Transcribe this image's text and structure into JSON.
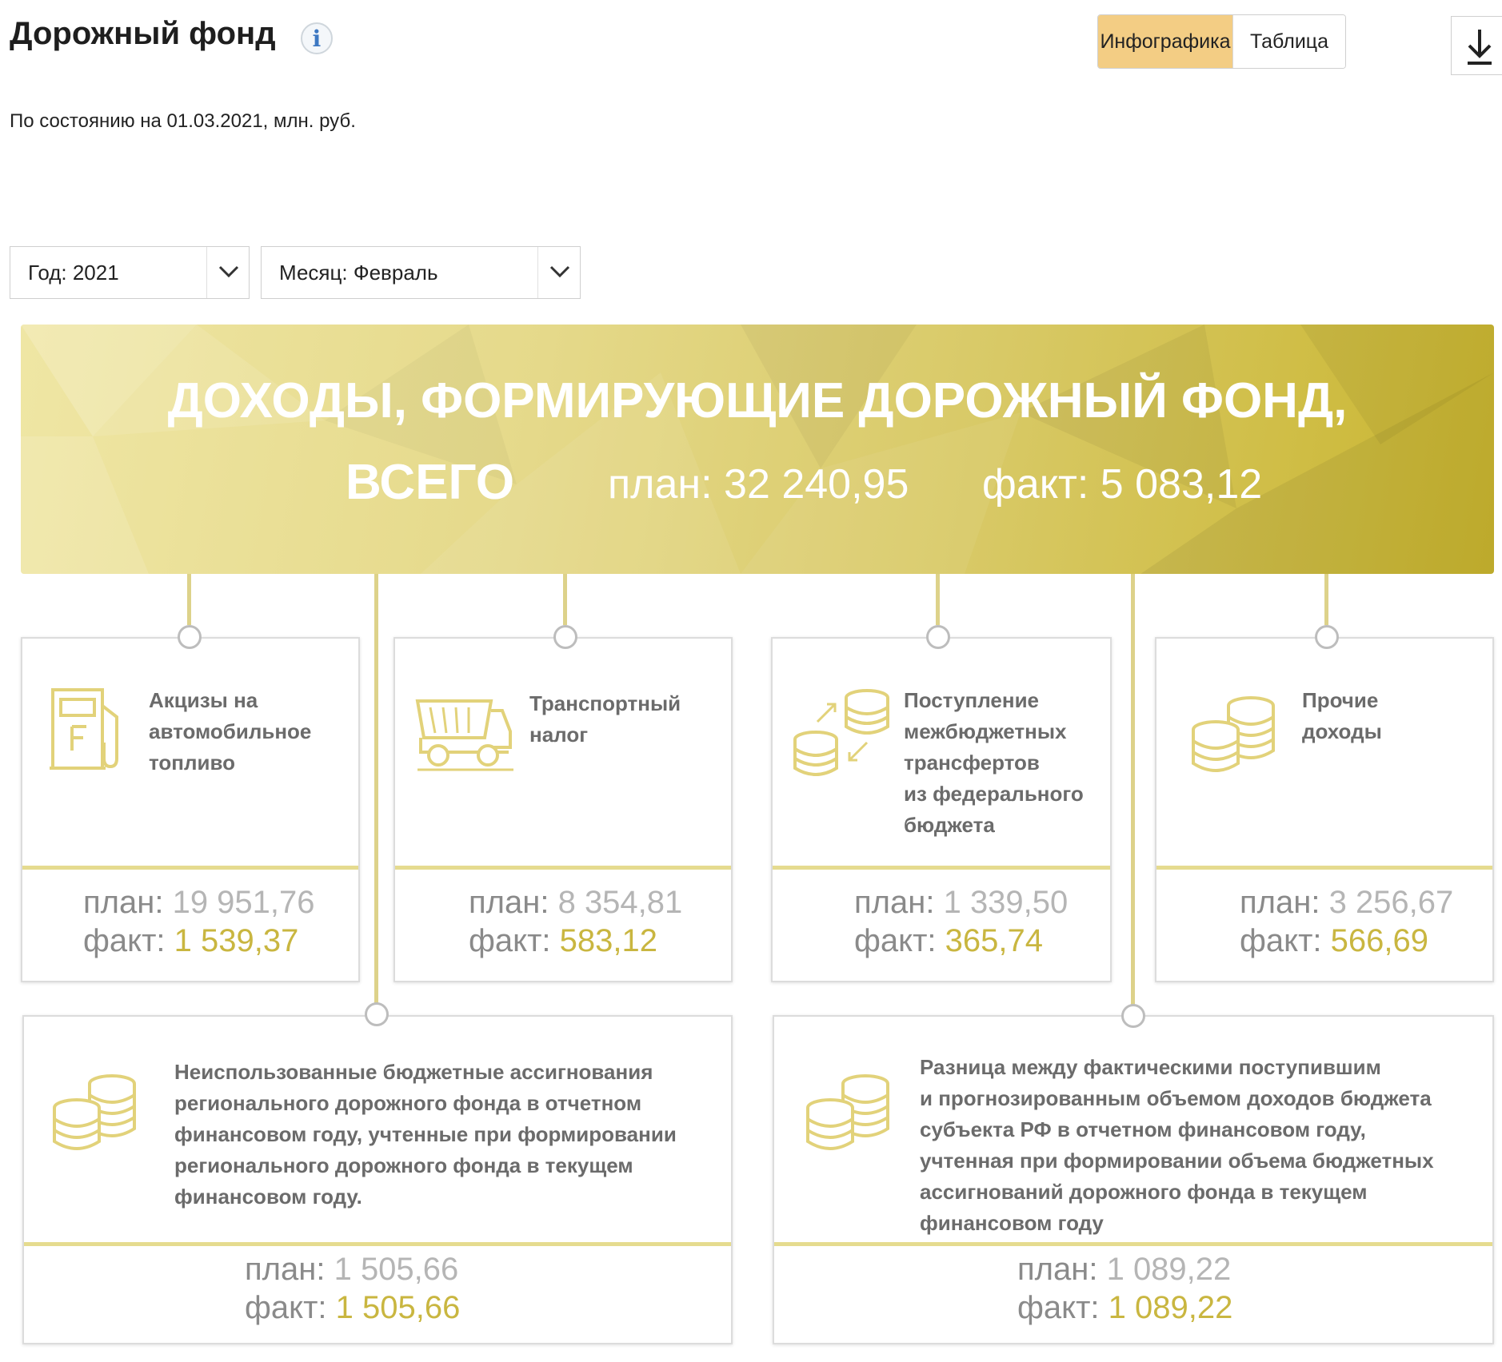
{
  "header": {
    "title": "Дорожный фонд",
    "info_label": "i",
    "tabs": [
      "Инфографика",
      "Таблица"
    ],
    "active_tab": "Инфографика",
    "subtitle": "По состоянию на 01.03.2021, млн. руб."
  },
  "filters": {
    "year": "Год: 2021",
    "month": "Месяц: Февраль"
  },
  "banner": {
    "title": "ДОХОДЫ, ФОРМИРУЮЩИЕ ДОРОЖНЫЙ ФОНД,",
    "title2": "ВСЕГО",
    "plan": "план: 32 240,95",
    "fact": "факт: 5 083,12"
  },
  "labels": {
    "plan": "план:",
    "fact": "факт:"
  },
  "colors": {
    "accent": "#c9b640",
    "banner": "#d8c966",
    "tab_active": "#f3cd84"
  },
  "cards": [
    {
      "name": "Акцизы на автомобильное топливо",
      "lines": [
        "Акцизы на",
        "автомобильное",
        "топливо"
      ],
      "icon": "fuel-pump-icon",
      "plan": "19 951,76",
      "fact": "1 539,37"
    },
    {
      "name": "Транспортный налог",
      "lines": [
        "Транспортный",
        " налог"
      ],
      "icon": "dump-truck-icon",
      "plan": "8 354,81",
      "fact": "583,12"
    },
    {
      "name": "Поступление межбюджетных трансфертов из федерального бюджета",
      "lines": [
        "Поступление",
        "межбюджетных",
        "трансфертов",
        "из федерального",
        "бюджета"
      ],
      "icon": "coins-transfer-icon",
      "plan": "1 339,50",
      "fact": "365,74"
    },
    {
      "name": "Прочие доходы",
      "lines": [
        "Прочие",
        "доходы"
      ],
      "icon": "coins-icon",
      "plan": "3 256,67",
      "fact": "566,69"
    },
    {
      "name": "Неиспользованные бюджетные ассигнования",
      "lines": [
        "Неиспользованные бюджетные ассигнования",
        "регионального дорожного фонда в отчетном",
        "финансовом году, учтенные при формировании",
        "регионального дорожного фонда в текущем",
        "финансовом году."
      ],
      "icon": "coins-icon",
      "plan": "1 505,66",
      "fact": "1 505,66"
    },
    {
      "name": "Разница между фактическими поступившим",
      "lines": [
        "Разница между фактическими поступившим",
        "и прогнозированным объемом доходов бюджета",
        "субъекта РФ в отчетном финансовом году,",
        "учтенная при формировании объема бюджетных",
        "ассигнований дорожного фонда в текущем",
        "финансовом году"
      ],
      "icon": "coins-icon",
      "plan": "1 089,22",
      "fact": "1 089,22"
    }
  ]
}
